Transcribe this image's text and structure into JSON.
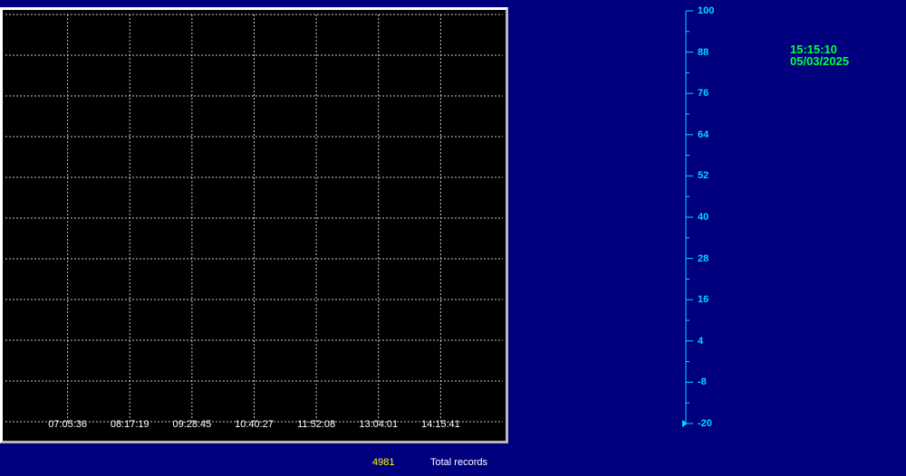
{
  "chart_data": {
    "type": "line",
    "x_ticks": [
      "07:05:36",
      "08:17:19",
      "09:28:45",
      "10:40:27",
      "11:52:08",
      "13:04:01",
      "14:15:41"
    ],
    "y_ticks": [
      "100",
      "88",
      "76",
      "64",
      "52",
      "40",
      "28",
      "16",
      "4",
      "-8",
      "-20"
    ],
    "ylim": [
      -20,
      100
    ],
    "grid": true,
    "series": []
  },
  "clock": {
    "time": "15:15:10",
    "date": "05/03/2025"
  },
  "footer": {
    "records_count": "4981",
    "records_label": "Total records"
  },
  "colors": {
    "background": "#00007f",
    "plot_background": "#000000",
    "grid": "#c8c8c8",
    "axis": "#00d8ff",
    "clock_text": "#00ff40",
    "count_text": "#ffff00"
  }
}
